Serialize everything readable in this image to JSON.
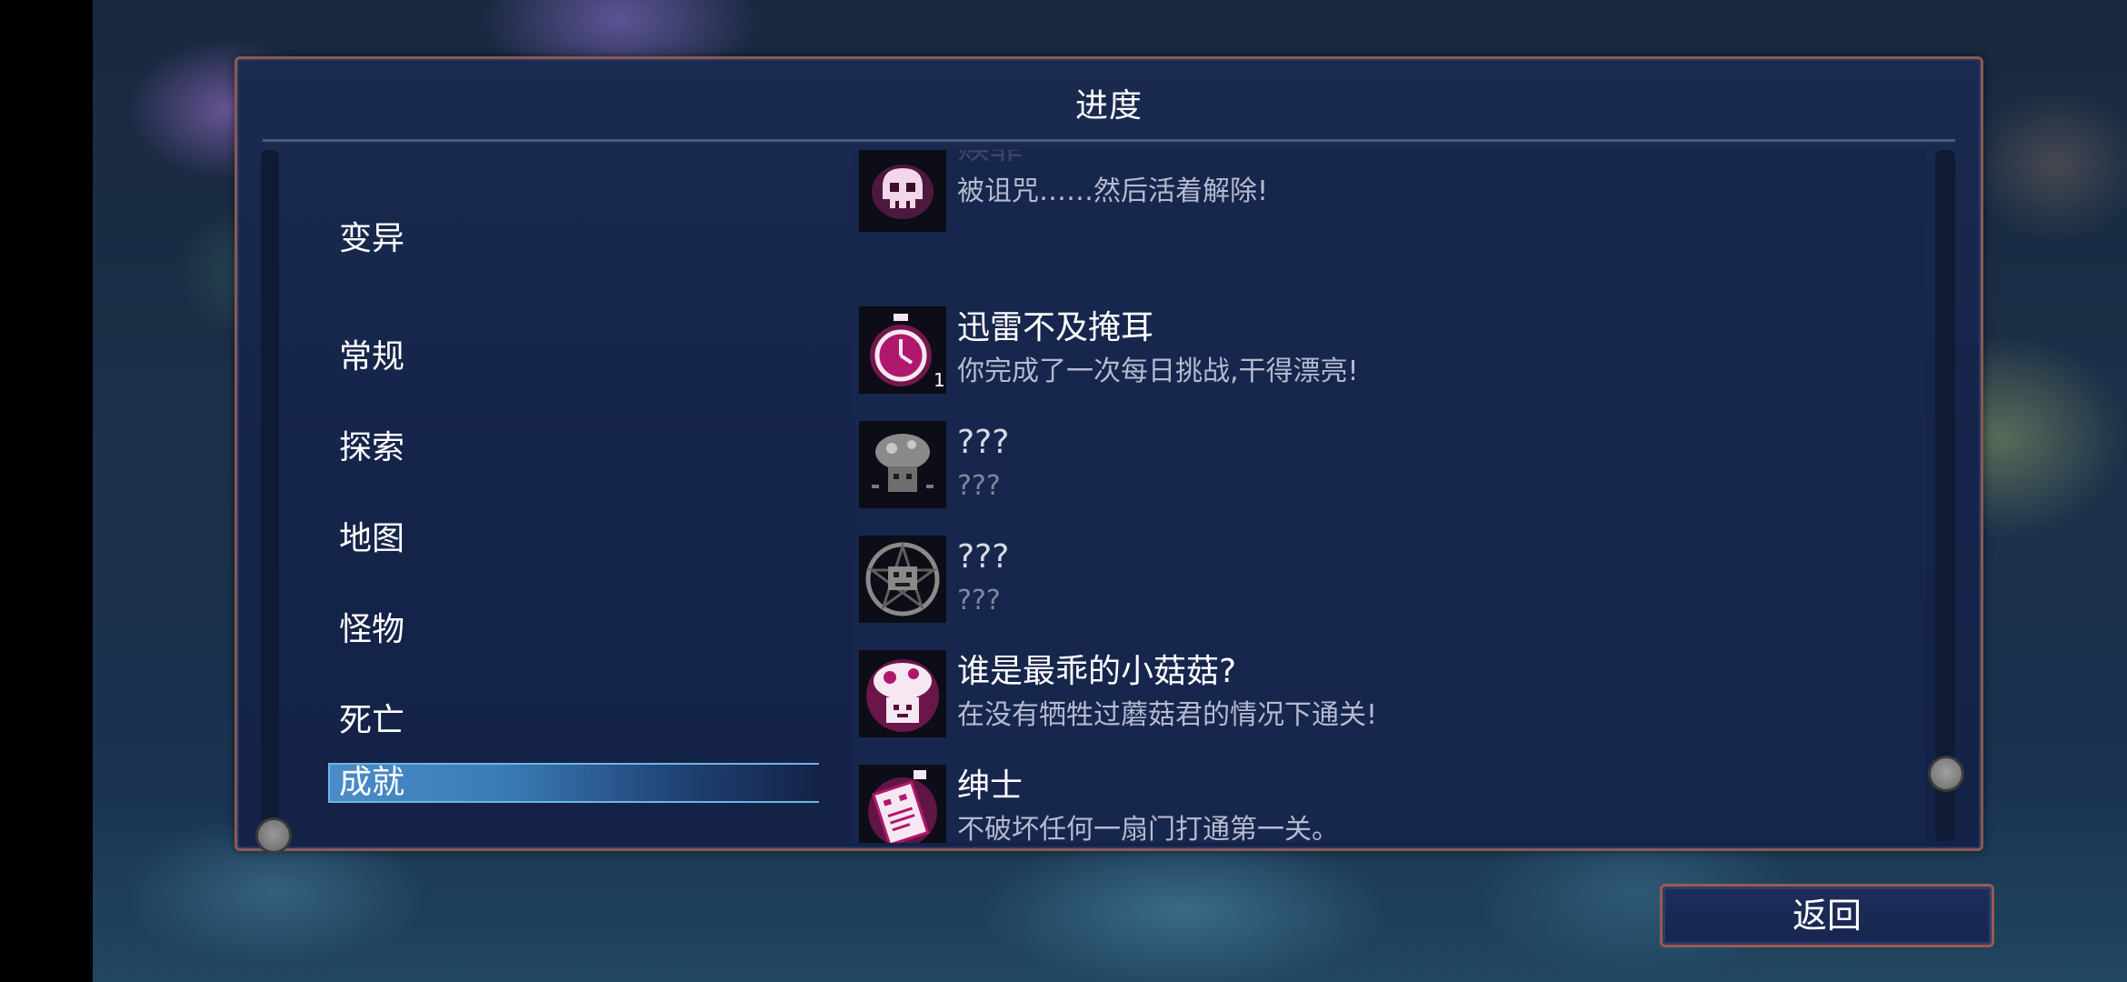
{
  "panel": {
    "title": "进度"
  },
  "categories": [
    {
      "label": "变异",
      "selected": false
    },
    {
      "label": "常规",
      "selected": false
    },
    {
      "label": "探索",
      "selected": false
    },
    {
      "label": "地图",
      "selected": false
    },
    {
      "label": "怪物",
      "selected": false
    },
    {
      "label": "死亡",
      "selected": false
    },
    {
      "label": "成就",
      "selected": true
    }
  ],
  "achievements": [
    {
      "name": "赎罪",
      "desc": "被诅咒……然后活着解除!",
      "icon": "cursed-skull-icon",
      "unlocked": true
    },
    {
      "name": "迅雷不及掩耳",
      "desc": "你完成了一次每日挑战,干得漂亮!",
      "icon": "stopwatch-icon",
      "unlocked": true,
      "badge": "1"
    },
    {
      "name": "???",
      "desc": "???",
      "icon": "mushroom-creature-icon",
      "unlocked": false
    },
    {
      "name": "???",
      "desc": "???",
      "icon": "pentagram-demon-icon",
      "unlocked": false
    },
    {
      "name": "谁是最乖的小菇菇?",
      "desc": "在没有牺牲过蘑菇君的情况下通关!",
      "icon": "mushroom-pet-icon",
      "unlocked": true
    },
    {
      "name": "绅士",
      "desc": "不破坏任何一扇门打通第一关。",
      "icon": "gentleman-card-icon",
      "unlocked": true
    }
  ],
  "buttons": {
    "back_label": "返回"
  },
  "colors": {
    "panel_border": "#8a5a56",
    "panel_bg": "#15244a",
    "selected_tab": "#4a8cc8",
    "icon_magenta": "#e02a8a"
  }
}
